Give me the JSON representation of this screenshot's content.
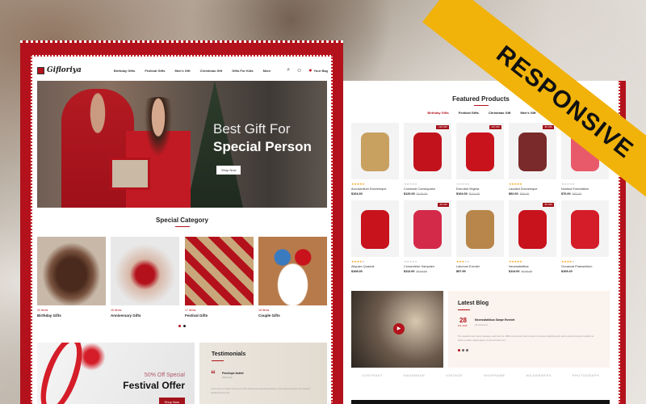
{
  "banner": {
    "text": "RESPONSIVE",
    "color": "#f1b20a"
  },
  "brand": {
    "name": "Gifloriya",
    "accent": "#b3121c"
  },
  "header": {
    "nav": [
      "Birthday Gifts",
      "Festival Gifts",
      "Men's Gift",
      "Christmas Gift",
      "Gifts For Kids",
      "More"
    ],
    "cart_label": "Your Bag",
    "icons": [
      "search-icon",
      "user-icon",
      "bag-icon"
    ]
  },
  "hero": {
    "line1": "Best Gift For",
    "line2": "Special Person",
    "button": "Shop Now"
  },
  "special_category": {
    "title": "Special Category",
    "items": [
      {
        "count": "20 Items",
        "name": "Birthday Gifts"
      },
      {
        "count": "15 Items",
        "name": "Anniversary Gifts"
      },
      {
        "count": "17 Items",
        "name": "Festival Gifts"
      },
      {
        "count": "18 Items",
        "name": "Couple Gifts"
      }
    ]
  },
  "festival": {
    "subtitle": "50% Off Special",
    "title": "Festival Offer",
    "button": "Shop Now"
  },
  "testimonials": {
    "title": "Testimonials",
    "name": "Penelope Astrid",
    "role": "(Marketing)",
    "text": "Lorem ipsum is simply dummy text of the printing and typesetting industry. Lorem Ipsum has been the industry's standard dummy text"
  },
  "featured": {
    "title": "Featured Products",
    "tabs": [
      "Birthday Gifts",
      "Festival Gifts",
      "Christmas Gift",
      "Men's Gift"
    ],
    "products": [
      {
        "name": "Accusantium Doloremque",
        "price": "$104.00",
        "old": "",
        "rating": 5,
        "badge": ""
      },
      {
        "name": "Commodi Consequatur",
        "price": "$120.00",
        "old": "$136.00",
        "rating": 0,
        "badge": "-12% OFF"
      },
      {
        "name": "Exercitat Virginia",
        "price": "$104.00",
        "old": "$116.00",
        "rating": 0,
        "badge": "-11% OFF"
      },
      {
        "name": "Laudant Doloremque",
        "price": "$92.00",
        "old": "$98.00",
        "rating": 5,
        "badge": "-6% OFF"
      },
      {
        "name": "Nostrud Exercitation",
        "price": "$76.00",
        "old": "$82.00",
        "rating": 0,
        "badge": ""
      },
      {
        "name": "Aliquam Quaerat",
        "price": "$108.00",
        "old": "",
        "rating": 4,
        "badge": ""
      },
      {
        "name": "Consectetur Hampden",
        "price": "$112.00",
        "old": "$118.00",
        "rating": 0,
        "badge": "-5% OFF"
      },
      {
        "name": "Laborum Eveniet",
        "price": "$97.99",
        "old": "",
        "rating": 3,
        "badge": ""
      },
      {
        "name": "Necessitatibus",
        "price": "$114.00",
        "old": "$120.00",
        "rating": 5,
        "badge": "-5% OFF"
      },
      {
        "name": "Occaecat Praesentium",
        "price": "$105.20",
        "old": "",
        "rating": 4,
        "badge": ""
      }
    ]
  },
  "blog": {
    "title": "Latest Blog",
    "day": "28",
    "month": "Feb, 2019",
    "post_title": "Necessitatibus Saepe Eveniet",
    "meta": "(0) Comments",
    "excerpt": "The standard Lorem Ipsum passage, used since the 1500s Lorem ipsum dolor sit amet, consectetur adipisicing elit, sed do eiusmod tempor incididunt ut labore et dolore magna aliqua. Ut enim ad minim ven..."
  },
  "brands": [
    "CONTRAST",
    "HANDMADE",
    "VINTAGE",
    "SHOPNAME",
    "WILDERNESS",
    "PHOTOGRAPH"
  ]
}
